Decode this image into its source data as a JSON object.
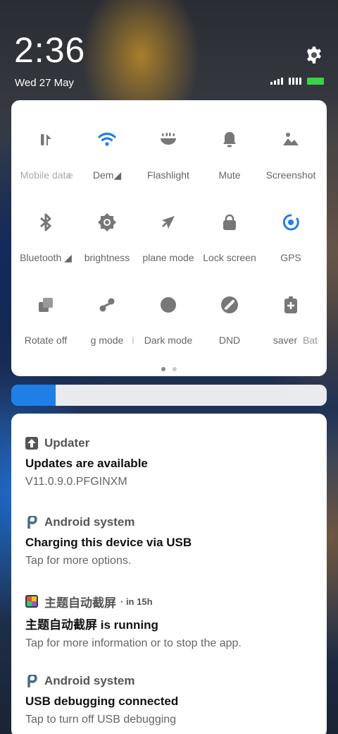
{
  "status": {
    "time": "2:36",
    "date": "Wed  27  May",
    "battery_color": "#3ad24a"
  },
  "quick_settings": {
    "accent": "#1f7fe6",
    "tiles": [
      {
        "label": "Mobile data",
        "icon": "mobile-data-icon",
        "active": false
      },
      {
        "label": "e",
        "icon": "",
        "active": false
      },
      {
        "label": "Dem◢",
        "icon": "wifi-icon",
        "active": true
      },
      {
        "label": "Flashlight",
        "icon": "flashlight-icon",
        "active": false
      },
      {
        "label": "Mute",
        "icon": "bell-icon",
        "active": false
      },
      {
        "label": "Screenshot",
        "icon": "screenshot-icon",
        "active": false
      },
      {
        "label": "Bluetooth ◢",
        "icon": "bluetooth-icon",
        "active": false
      },
      {
        "label": "brightness",
        "icon": "brightness-icon",
        "active": false
      },
      {
        "label": "plane mode",
        "icon": "airplane-icon",
        "active": false
      },
      {
        "label": "Lock screen",
        "icon": "lock-icon",
        "active": false
      },
      {
        "label": "GPS",
        "icon": "gps-icon",
        "active": true
      },
      {
        "label": "Rotate off",
        "icon": "rotate-icon",
        "active": false
      },
      {
        "label": "g mode",
        "icon": "reading-mode-icon",
        "active": false
      },
      {
        "label": "I",
        "icon": "",
        "active": false
      },
      {
        "label": "Dark mode",
        "icon": "dark-mode-icon",
        "active": false
      },
      {
        "label": "DND",
        "icon": "dnd-icon",
        "active": false
      },
      {
        "label": "saver",
        "icon": "battery-saver-icon",
        "active": false
      },
      {
        "label": "Bat",
        "icon": "",
        "active": false
      }
    ],
    "page_count": 2,
    "current_page": 1
  },
  "brightness": {
    "level": 0.14
  },
  "notifications": [
    {
      "app": "Updater",
      "when": "",
      "title": "Updates are available",
      "text": "V11.0.9.0.PFGINXM",
      "icon": "updater-icon"
    },
    {
      "app": "Android system",
      "when": "",
      "title": "Charging this device via USB",
      "text": "Tap for more options.",
      "icon": "android-system-icon"
    },
    {
      "app": "主题自动截屏",
      "when": "· in 15h",
      "title": "主题自动截屏 is running",
      "text": "Tap for more information or to stop the app.",
      "icon": "app-icon"
    },
    {
      "app": "Android system",
      "when": "",
      "title": "USB debugging connected",
      "text": "Tap to turn off USB debugging",
      "icon": "android-system-icon"
    }
  ]
}
